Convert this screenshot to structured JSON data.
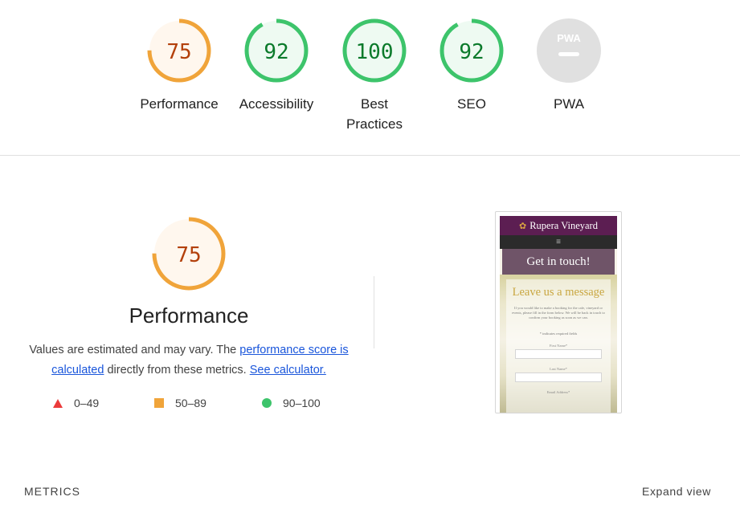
{
  "scores": [
    {
      "label": "Performance",
      "value": "75",
      "fraction": 0.75,
      "level": "average"
    },
    {
      "label": "Accessibility",
      "value": "92",
      "fraction": 0.92,
      "level": "pass"
    },
    {
      "label": "Best Practices",
      "value": "100",
      "fraction": 1.0,
      "level": "pass"
    },
    {
      "label": "SEO",
      "value": "92",
      "fraction": 0.92,
      "level": "pass"
    },
    {
      "label": "PWA",
      "value": "PWA",
      "fraction": 0,
      "level": "na"
    }
  ],
  "colors": {
    "average_fg": "#f0a43a",
    "average_bg": "#fff7ee",
    "average_text": "#b3400b",
    "pass_fg": "#3dc46b",
    "pass_bg": "#eefaf2",
    "pass_text": "#0b7a2b",
    "na_bg": "#e0e0e0",
    "na_text": "#ffffff",
    "fail": "#eb3b3b",
    "link": "#1a56db"
  },
  "performance": {
    "score": "75",
    "score_fraction": 0.75,
    "title": "Performance",
    "desc_pre": "Values are estimated and may vary. The ",
    "link_score": "performance score is calculated",
    "desc_mid": " directly from these metrics. ",
    "link_calc": "See calculator.",
    "legend": [
      {
        "shape": "triangle",
        "range": "0–49"
      },
      {
        "shape": "square",
        "range": "50–89"
      },
      {
        "shape": "circle",
        "range": "90–100"
      }
    ]
  },
  "screenshot": {
    "site_title": "Rupera Vineyard",
    "nav_icon": "menu-icon",
    "hero_text": "Get in touch!",
    "heading": "Leave us a message",
    "body_text": "If you would like to make a booking for the cafe, vineyard or events, please fill in the form below. We will be back in touch to confirm your booking as soon as we can.",
    "required_note": "* indicates required fields",
    "field_labels": [
      "First Name*",
      "Last Name*",
      "Email Address*"
    ]
  },
  "metrics": {
    "label": "METRICS",
    "expand": "Expand view"
  }
}
